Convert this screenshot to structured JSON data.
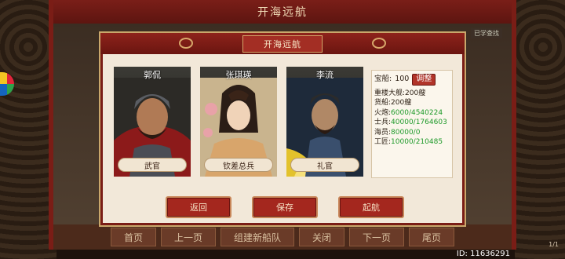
{
  "outer_title": "开海远航",
  "outer_list_label": "已学查找",
  "dialog": {
    "title": "开海远航",
    "officers": [
      {
        "name": "郭侃",
        "role": "武官"
      },
      {
        "name": "张琪瑛",
        "role": "钦差总兵"
      },
      {
        "name": "李流",
        "role": "礼官"
      }
    ],
    "stats": {
      "treasure_ship_label": "宝船:",
      "treasure_ship_value": "100",
      "adjust_label": "调整",
      "lines": [
        {
          "label": "重楼大舰:",
          "value": "200艘",
          "color": "black"
        },
        {
          "label": "货船:",
          "value": "200艘",
          "color": "black"
        },
        {
          "label": "火炮:",
          "value": "6000/4540224",
          "color": "green"
        },
        {
          "label": "士兵:",
          "value": "40000/1764603",
          "color": "green"
        },
        {
          "label": "海员:",
          "value": "80000/0",
          "color": "green"
        },
        {
          "label": "工匠:",
          "value": "10000/210485",
          "color": "green"
        }
      ]
    },
    "actions": {
      "back": "返回",
      "save": "保存",
      "sail": "起航"
    }
  },
  "bottom_bar": [
    "首页",
    "上一页",
    "组建新船队",
    "关闭",
    "下一页",
    "尾页"
  ],
  "page_indicator": "1/1",
  "user_id": "ID: 11636291"
}
